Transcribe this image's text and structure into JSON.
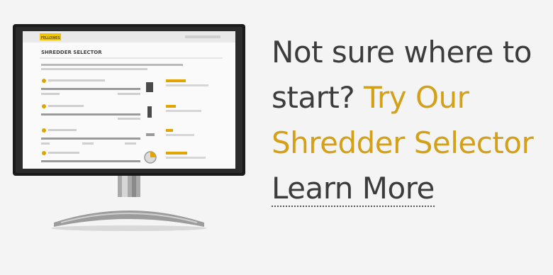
{
  "promo": {
    "line1": "Not sure where to",
    "line2_prefix": "start?",
    "line2_link": "Try Our",
    "line3_link": "Shredder Selector",
    "learn_more": "Learn More"
  },
  "screen": {
    "badge": "FELLOWES",
    "title": "SHREDDER SELECTOR"
  },
  "colors": {
    "accent": "#d4a017",
    "text": "#3c3c3c",
    "background": "#f4f4f4"
  },
  "icons": {
    "monitor": "monitor-icon"
  }
}
